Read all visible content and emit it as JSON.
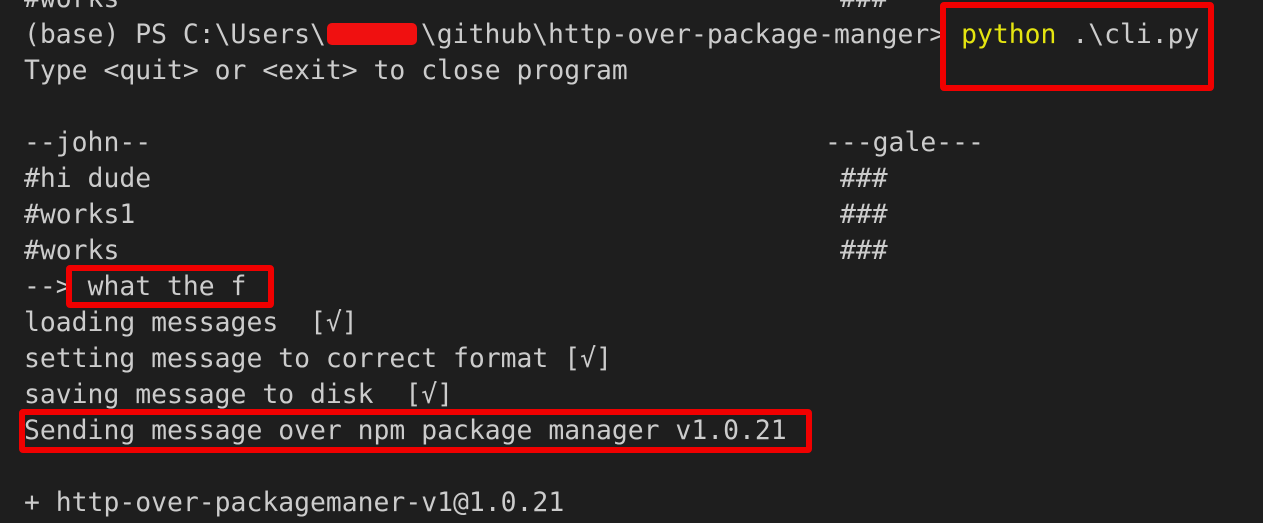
{
  "terminal": {
    "lines": [
      {
        "left": "#works",
        "right": "###"
      },
      {
        "prompt": "(base) PS C:\\Users\\",
        "prompt_rest": "\\github\\http-over-package-manger> ",
        "command": "python",
        "args": " .\\cli.py"
      },
      {
        "left": "Type <quit> or <exit> to close program"
      },
      {
        "left": ""
      },
      {
        "left": "--john--",
        "right": "---gale---"
      },
      {
        "left": "#hi dude",
        "right": "###"
      },
      {
        "left": "#works1",
        "right": "###"
      },
      {
        "left": "#works",
        "right": "###"
      },
      {
        "prompt": "--> ",
        "input": "what the f"
      },
      {
        "left": "loading messages  [√]"
      },
      {
        "left": "setting message to correct format [√]"
      },
      {
        "left": "saving message to disk  [√]"
      },
      {
        "left": "Sending message over npm package manager v1.0.21"
      },
      {
        "left": ""
      },
      {
        "left": "+ http-over-packagemaner-v1@1.0.21"
      }
    ]
  },
  "colors": {
    "background": "#1e1e1e",
    "text": "#cccccc",
    "command": "#e5e510",
    "highlight_box": "#f00000",
    "redaction": "#f01010"
  }
}
